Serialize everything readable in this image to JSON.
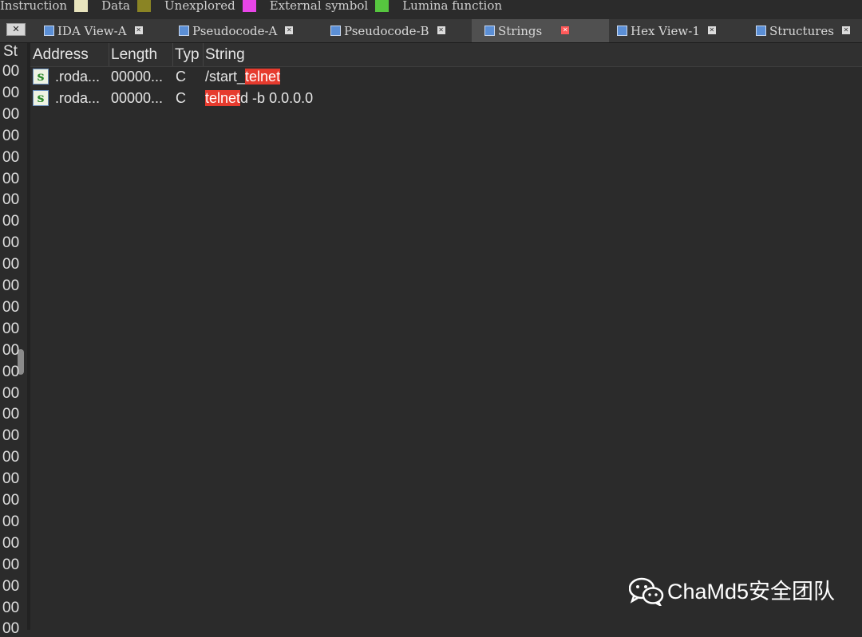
{
  "legend": [
    {
      "label": "Instruction",
      "color": null
    },
    {
      "label": "Data",
      "color": "#e8e4bd"
    },
    {
      "label": "Unexplored",
      "color": "#8a8424"
    },
    {
      "label": "External symbol",
      "color": "#e845e8"
    },
    {
      "label": "Lumina function",
      "color": "#56c63f"
    }
  ],
  "tabs": [
    {
      "label": "IDA View-A",
      "icon": "ida-view-icon",
      "active": false
    },
    {
      "label": "Pseudocode-A",
      "icon": "pseudocode-icon",
      "active": false
    },
    {
      "label": "Pseudocode-B",
      "icon": "pseudocode-icon",
      "active": false
    },
    {
      "label": "Strings",
      "icon": "strings-icon",
      "active": true
    },
    {
      "label": "Hex View-1",
      "icon": "hex-view-icon",
      "active": false
    },
    {
      "label": "Structures",
      "icon": "structures-icon",
      "active": false
    }
  ],
  "left_pane": {
    "header": "St",
    "row_text": "00",
    "row_count": 27
  },
  "strings_table": {
    "columns": [
      "Address",
      "Length",
      "Typ",
      "String"
    ],
    "rows": [
      {
        "address": ".roda...",
        "length": "00000...",
        "type": "C",
        "string_parts": [
          {
            "text": "/start_",
            "hl": false
          },
          {
            "text": "telnet",
            "hl": true
          }
        ]
      },
      {
        "address": ".roda...",
        "length": "00000...",
        "type": "C",
        "string_parts": [
          {
            "text": "telnet",
            "hl": true
          },
          {
            "text": "d -b 0.0.0.0",
            "hl": false
          }
        ]
      }
    ],
    "highlight_color": "#e63b2e"
  },
  "watermark": {
    "text": "ChaMd5安全团队",
    "icon": "wechat-icon"
  }
}
